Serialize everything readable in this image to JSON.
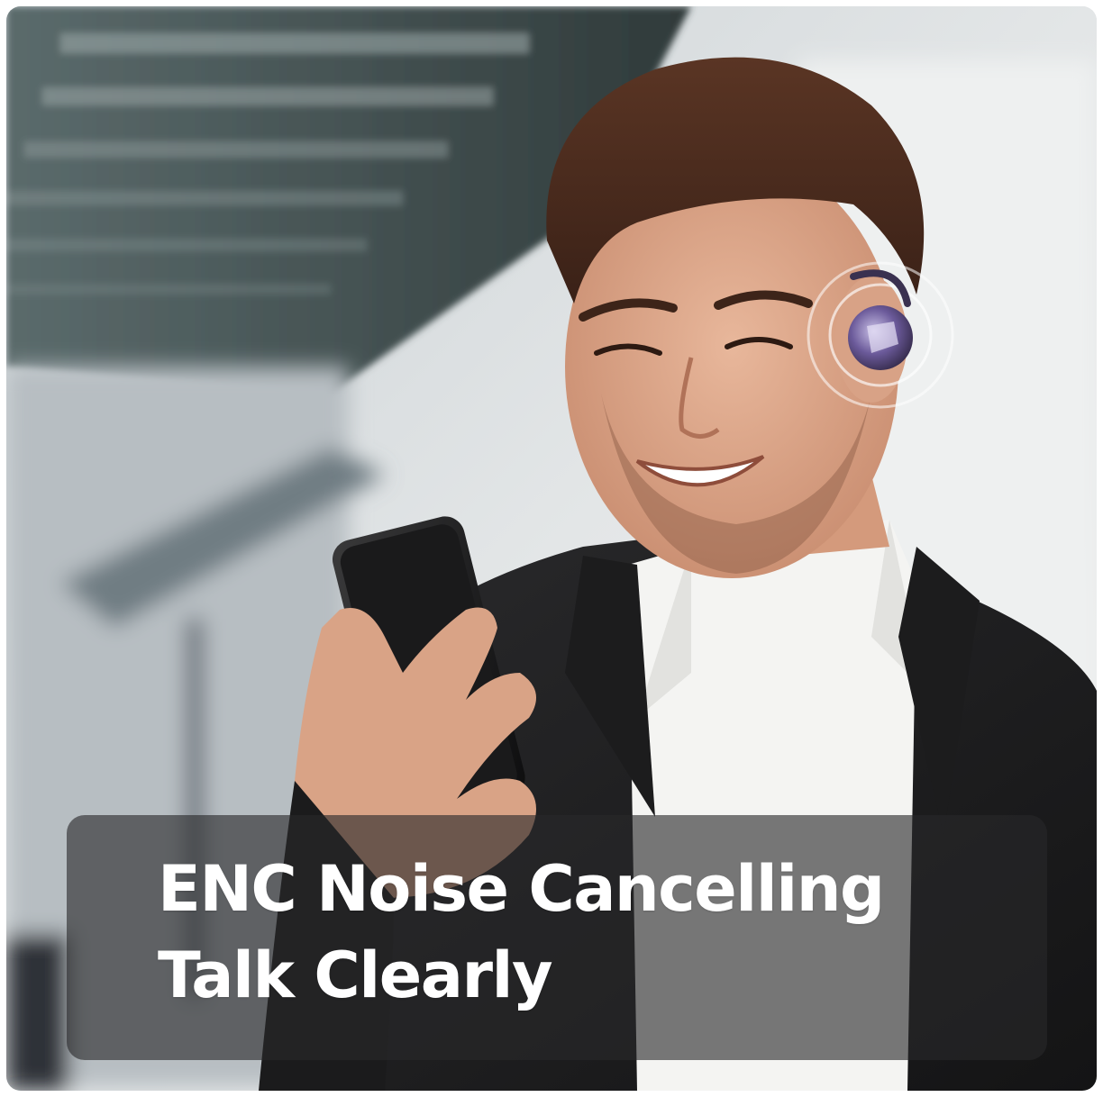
{
  "caption": {
    "line1": "ENC Noise Cancelling",
    "line2": "Talk Clearly"
  },
  "colors": {
    "panel": "#28282a",
    "text": "#ffffff",
    "earbud_accent": "#6b5a9a"
  }
}
